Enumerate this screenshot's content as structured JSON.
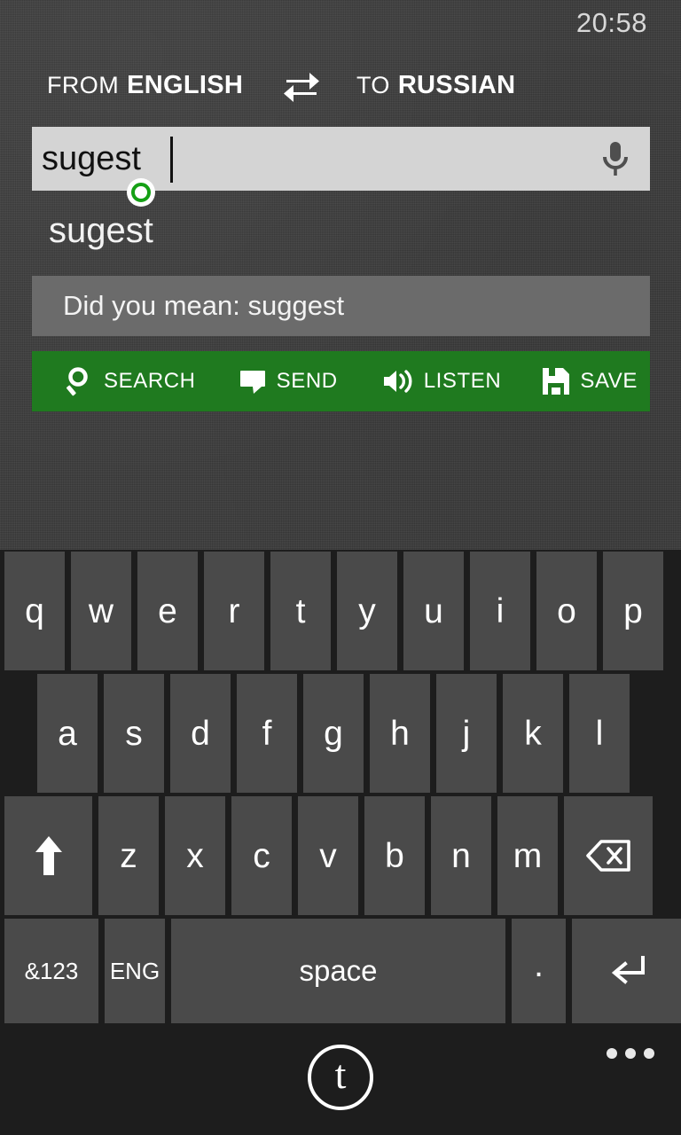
{
  "status": {
    "time": "20:58"
  },
  "header": {
    "from_prefix": "FROM",
    "from_language": "ENGLISH",
    "swap_icon": "swap-horizontal-icon",
    "to_prefix": "TO",
    "to_language": "RUSSIAN"
  },
  "input": {
    "value": "sugest",
    "placeholder": "",
    "mic_icon": "microphone-icon",
    "cursor_handle_icon": "text-cursor-handle"
  },
  "result": {
    "source_word": "sugest"
  },
  "suggestion": {
    "text": "Did you mean: suggest"
  },
  "actions": [
    {
      "label": "SEARCH",
      "icon": "search-icon"
    },
    {
      "label": "SEND",
      "icon": "speech-bubble-icon"
    },
    {
      "label": "LISTEN",
      "icon": "speaker-icon"
    },
    {
      "label": "SAVE",
      "icon": "floppy-disk-icon"
    }
  ],
  "keyboard": {
    "row1": [
      {
        "label": "q"
      },
      {
        "label": "w"
      },
      {
        "label": "e"
      },
      {
        "label": "r"
      },
      {
        "label": "t"
      },
      {
        "label": "y"
      },
      {
        "label": "u"
      },
      {
        "label": "i"
      },
      {
        "label": "o"
      },
      {
        "label": "p"
      }
    ],
    "row2": [
      {
        "label": "a"
      },
      {
        "label": "s"
      },
      {
        "label": "d"
      },
      {
        "label": "f"
      },
      {
        "label": "g"
      },
      {
        "label": "h"
      },
      {
        "label": "j"
      },
      {
        "label": "k"
      },
      {
        "label": "l"
      }
    ],
    "row3": [
      {
        "label": "",
        "icon": "shift-up-arrow-icon",
        "name": "shift"
      },
      {
        "label": "z"
      },
      {
        "label": "x"
      },
      {
        "label": "c"
      },
      {
        "label": "v"
      },
      {
        "label": "b"
      },
      {
        "label": "n"
      },
      {
        "label": "m"
      },
      {
        "label": "",
        "icon": "backspace-icon",
        "name": "backspace"
      }
    ],
    "row4": [
      {
        "label": "&123",
        "name": "numbers-symbols"
      },
      {
        "label": "ENG",
        "name": "language"
      },
      {
        "label": "space",
        "name": "space"
      },
      {
        "label": ".",
        "name": "period"
      },
      {
        "label": "",
        "icon": "enter-return-icon",
        "name": "enter"
      }
    ]
  },
  "appbar": {
    "logo_letter": "t",
    "more_icon": "ellipsis-icon"
  },
  "colors": {
    "accent_green": "#1f7a1f",
    "app_background": "#3b3b3b",
    "keyboard_background": "#1d1d1d",
    "key": "#4a4a4a",
    "input_background": "#d4d4d4",
    "suggestion_background": "#6b6b6b",
    "cursor_handle_ring": "#15a015"
  }
}
